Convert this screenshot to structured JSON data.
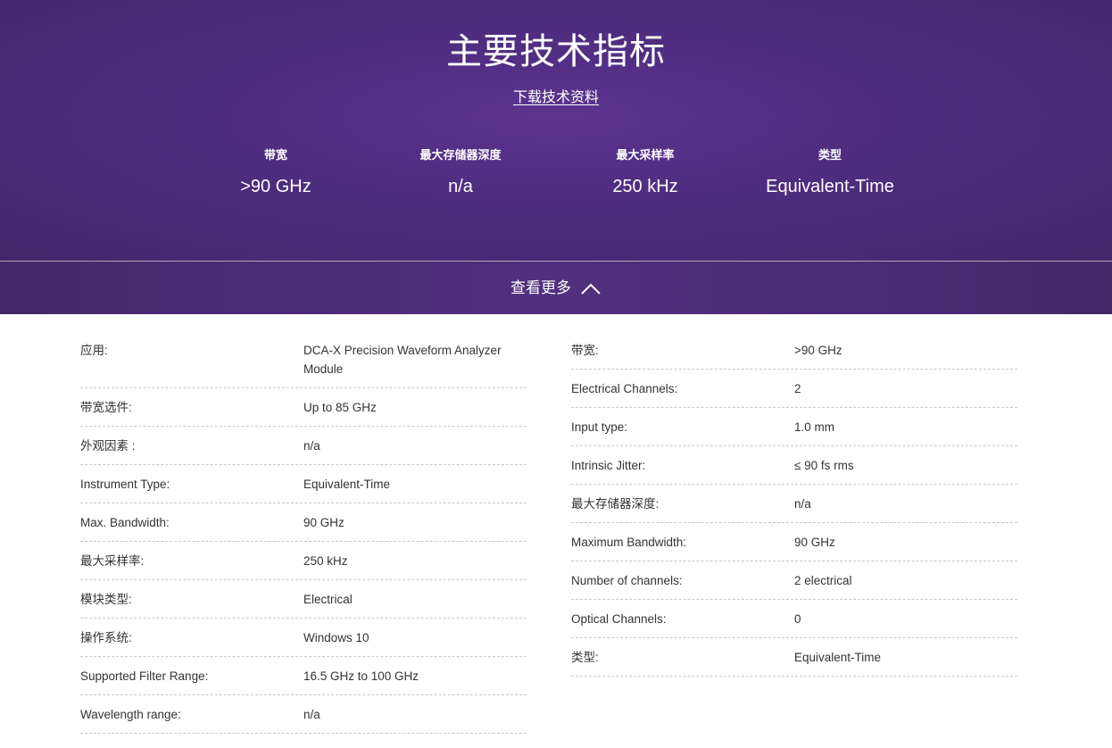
{
  "hero": {
    "title": "主要技术指标",
    "download_link": "下载技术资料",
    "metrics": [
      {
        "label": "带宽",
        "value": ">90 GHz"
      },
      {
        "label": "最大存储器深度",
        "value": "n/a"
      },
      {
        "label": "最大采样率",
        "value": "250 kHz"
      },
      {
        "label": "类型",
        "value": "Equivalent-Time"
      }
    ]
  },
  "more_bar": {
    "label": "查看更多",
    "icon": "chevron-up-icon"
  },
  "specs_left": [
    {
      "key": "应用:",
      "value": "DCA-X Precision Waveform Analyzer Module"
    },
    {
      "key": "带宽选件:",
      "value": "Up to 85 GHz"
    },
    {
      "key": "外观因素 :",
      "value": "n/a"
    },
    {
      "key": "Instrument Type:",
      "value": "Equivalent-Time"
    },
    {
      "key": "Max. Bandwidth:",
      "value": "90 GHz"
    },
    {
      "key": "最大采样率:",
      "value": "250 kHz"
    },
    {
      "key": "模块类型:",
      "value": "Electrical"
    },
    {
      "key": "操作系统:",
      "value": "Windows 10"
    },
    {
      "key": "Supported Filter Range:",
      "value": "16.5 GHz to 100 GHz"
    },
    {
      "key": "Wavelength range:",
      "value": "n/a"
    }
  ],
  "specs_right": [
    {
      "key": "带宽:",
      "value": ">90 GHz"
    },
    {
      "key": "Electrical Channels:",
      "value": "2"
    },
    {
      "key": "Input type:",
      "value": "1.0 mm"
    },
    {
      "key": "Intrinsic Jitter:",
      "value": "≤ 90 fs rms"
    },
    {
      "key": "最大存储器深度:",
      "value": "n/a"
    },
    {
      "key": "Maximum Bandwidth:",
      "value": "90 GHz"
    },
    {
      "key": "Number of channels:",
      "value": "2 electrical"
    },
    {
      "key": "Optical Channels:",
      "value": "0"
    },
    {
      "key": "类型:",
      "value": "Equivalent-Time"
    }
  ]
}
